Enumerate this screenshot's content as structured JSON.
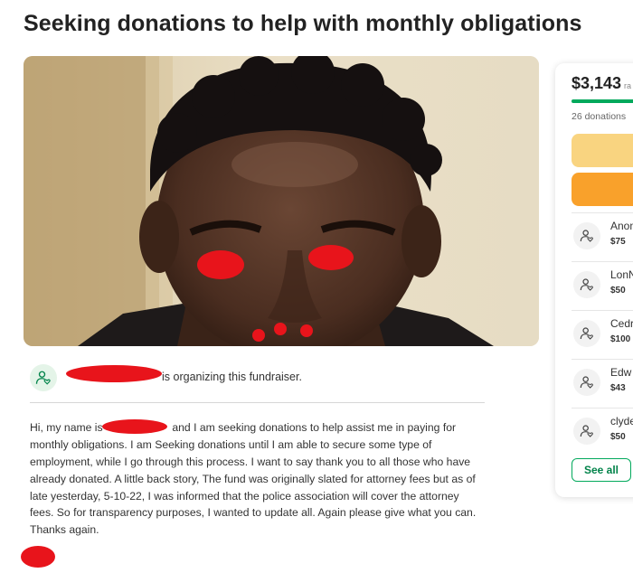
{
  "page": {
    "title": "Seeking donations to help with monthly obligations"
  },
  "organizer": {
    "text": "is organizing this fundraiser."
  },
  "story": {
    "lines": [
      [
        "Hi, my name is",
        "and I am seeking donations to help assist me in paying for"
      ],
      [
        "monthly obligations. I am Seeking donations until I am able to secure some type of"
      ],
      [
        "employment, while I go through this process. I want to say thank you to all those who have"
      ],
      [
        "already donated. A little back story, The fund was originally slated for attorney fees but as of"
      ],
      [
        "late yesterday, 5-10-22, I was informed that the police association will cover the attorney"
      ],
      [
        "fees. So for transparency purposes, I wanted to update all. Again please give what you can."
      ],
      [
        "Thanks again."
      ]
    ]
  },
  "sidebar": {
    "amount": "$3,143",
    "raised_fragment": "ra",
    "progress_fraction": 0.85,
    "donation_count": "26 donations",
    "share_label": "",
    "donate_label": "",
    "see_all_label": "See all",
    "donors": [
      {
        "name": "Anon",
        "amount": "$75"
      },
      {
        "name": "LonN",
        "amount": "$50"
      },
      {
        "name": "Cedr",
        "amount": "$100"
      },
      {
        "name": "Edw",
        "amount": "$43"
      },
      {
        "name": "clyde",
        "amount": "$50"
      }
    ]
  },
  "colors": {
    "accent_green": "#02a95c",
    "share_button": "#f9d480",
    "donate_button": "#f9a12b",
    "redaction": "#e8141b"
  },
  "icons": {
    "organizer_avatar": "user-heart-icon",
    "donor_avatar": "user-heart-icon"
  }
}
